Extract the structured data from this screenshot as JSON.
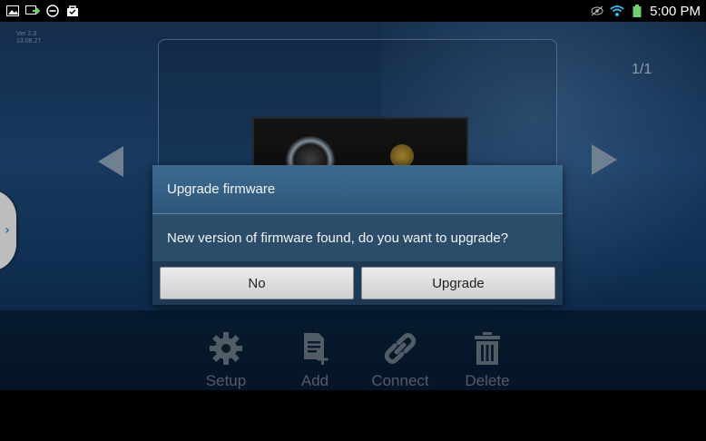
{
  "status_bar": {
    "time": "5:00 PM",
    "left_icons": [
      "image-icon",
      "cast-icon",
      "minus-circle-icon",
      "bag-icon"
    ],
    "right_icons": [
      "eye-icon",
      "wifi-icon",
      "battery-icon"
    ]
  },
  "app": {
    "version_line1": "Ver 2.3",
    "version_line2": "13.08.27",
    "pager": "1/1"
  },
  "toolbar": {
    "items": [
      {
        "label": "Setup"
      },
      {
        "label": "Add"
      },
      {
        "label": "Connect"
      },
      {
        "label": "Delete"
      }
    ]
  },
  "dialog": {
    "title": "Upgrade firmware",
    "message": "New version of firmware found, do you want to upgrade?",
    "buttons": {
      "no": "No",
      "upgrade": "Upgrade"
    }
  },
  "colors": {
    "accent": "#3a8fc7",
    "dialog_title_bg": "#3d6b8e",
    "dialog_body_bg": "#2b4d69"
  }
}
